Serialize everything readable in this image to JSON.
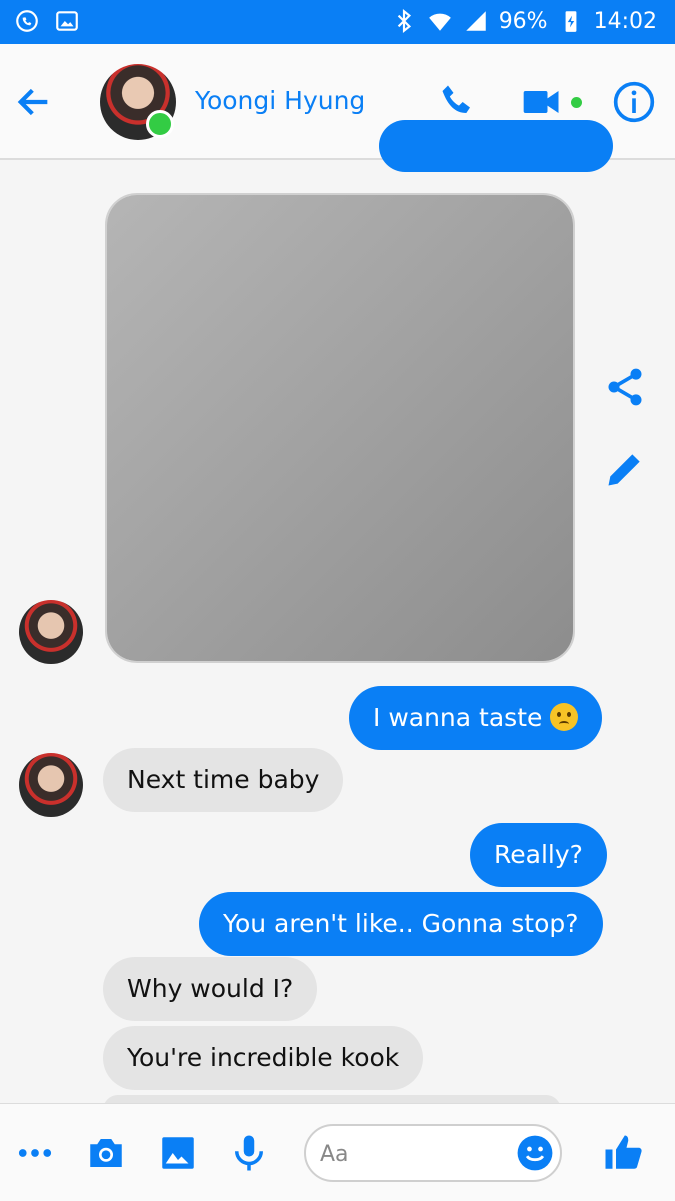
{
  "status_bar": {
    "battery": "96%",
    "time": "14:02"
  },
  "header": {
    "contact_name": "Yoongi Hyung"
  },
  "photo": {
    "label": "Shared photo — content not reproduced"
  },
  "messages": [
    {
      "side": "out",
      "text": "I wanna taste",
      "emoji": "sad-face"
    },
    {
      "side": "in",
      "text": "Next time baby"
    },
    {
      "side": "out",
      "text": "Really?"
    },
    {
      "side": "out",
      "text": "You aren't like.. Gonna stop?"
    },
    {
      "side": "in",
      "text": "Why would I?"
    },
    {
      "side": "in",
      "text": "You're incredible kook"
    }
  ],
  "composer": {
    "placeholder": "Aa"
  },
  "colors": {
    "accent": "#0a7ff5",
    "incoming": "#e4e4e4",
    "online": "#33cc44"
  }
}
